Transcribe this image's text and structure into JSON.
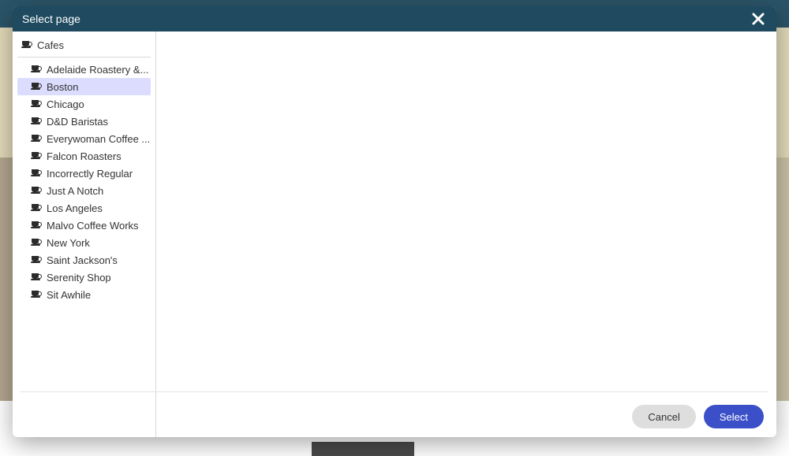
{
  "modal": {
    "title": "Select page",
    "footer": {
      "cancel": "Cancel",
      "select": "Select"
    }
  },
  "tree": {
    "root": {
      "label": "Cafes",
      "icon": "cup-icon"
    },
    "children": [
      {
        "label": "Adelaide Roastery &...",
        "icon": "cup-icon",
        "selected": false
      },
      {
        "label": "Boston",
        "icon": "cup-icon",
        "selected": true
      },
      {
        "label": "Chicago",
        "icon": "cup-icon",
        "selected": false
      },
      {
        "label": "D&D Baristas",
        "icon": "cup-icon",
        "selected": false
      },
      {
        "label": "Everywoman Coffee ...",
        "icon": "cup-icon",
        "selected": false
      },
      {
        "label": "Falcon Roasters",
        "icon": "cup-icon",
        "selected": false
      },
      {
        "label": "Incorrectly Regular",
        "icon": "cup-icon",
        "selected": false
      },
      {
        "label": "Just A Notch",
        "icon": "cup-icon",
        "selected": false
      },
      {
        "label": "Los Angeles",
        "icon": "cup-icon",
        "selected": false
      },
      {
        "label": "Malvo Coffee Works",
        "icon": "cup-icon",
        "selected": false
      },
      {
        "label": "New York",
        "icon": "cup-icon",
        "selected": false
      },
      {
        "label": "Saint Jackson's",
        "icon": "cup-icon",
        "selected": false
      },
      {
        "label": "Serenity Shop",
        "icon": "cup-icon",
        "selected": false
      },
      {
        "label": "Sit Awhile",
        "icon": "cup-icon",
        "selected": false
      }
    ]
  }
}
